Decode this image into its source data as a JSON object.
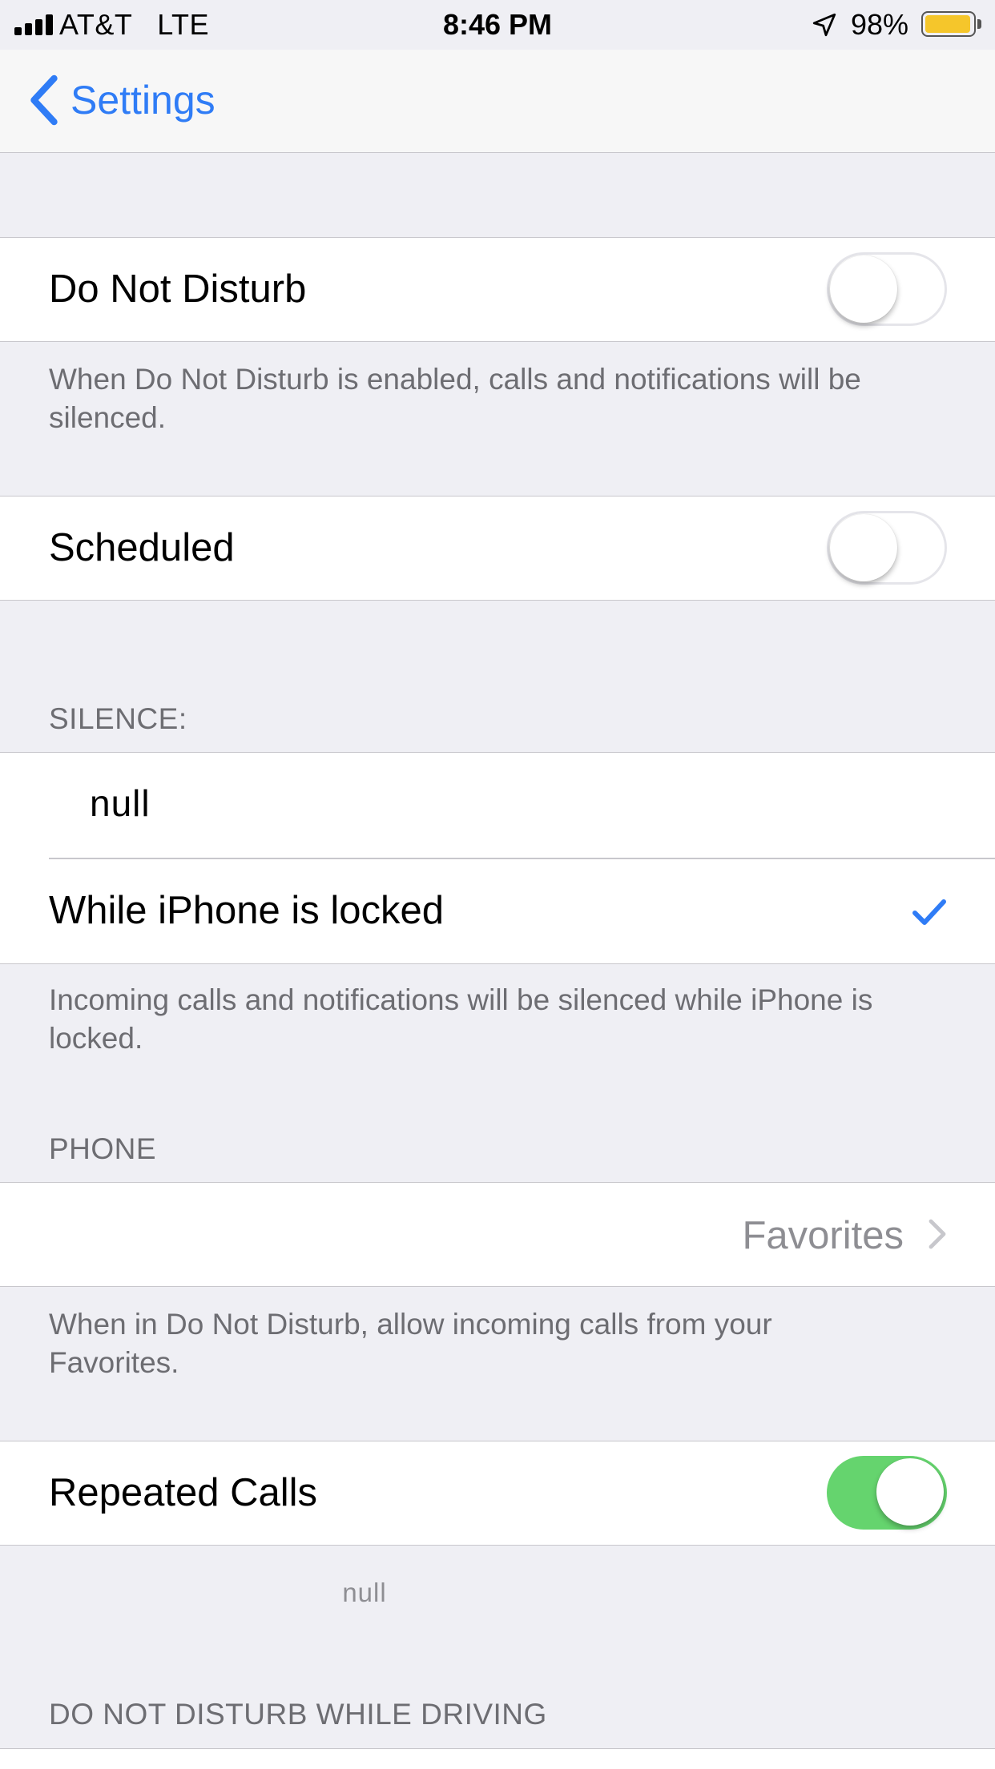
{
  "status_bar": {
    "carrier": "AT&T   LTE",
    "time": "8:46 PM",
    "battery_percent": "98%",
    "battery_level": 0.98,
    "battery_color": "#f5c62b",
    "icons": [
      "signal-bars-icon",
      "location-arrow-icon",
      "battery-icon"
    ]
  },
  "nav": {
    "back_label": "Settings",
    "accent_color": "#2f7cf6"
  },
  "do_not_disturb": {
    "label": "Do Not Disturb",
    "enabled": false,
    "footer": "When Do Not Disturb is enabled, calls and notifications will be silenced."
  },
  "scheduled": {
    "label": "Scheduled",
    "enabled": false
  },
  "silence": {
    "header": "SILENCE:",
    "option_always": "null",
    "option_locked": "While iPhone is locked",
    "selected": "While iPhone is locked",
    "footer": "Incoming calls and notifications will be silenced while iPhone is locked."
  },
  "phone": {
    "header": "PHONE",
    "allow_calls_value": "Favorites",
    "footer": "When in Do Not Disturb, allow incoming calls from your Favorites."
  },
  "repeated_calls": {
    "label": "Repeated Calls",
    "enabled": true,
    "toggle_on_color": "#65d46e",
    "footer": "null"
  },
  "driving": {
    "header": "DO NOT DISTURB WHILE DRIVING"
  }
}
